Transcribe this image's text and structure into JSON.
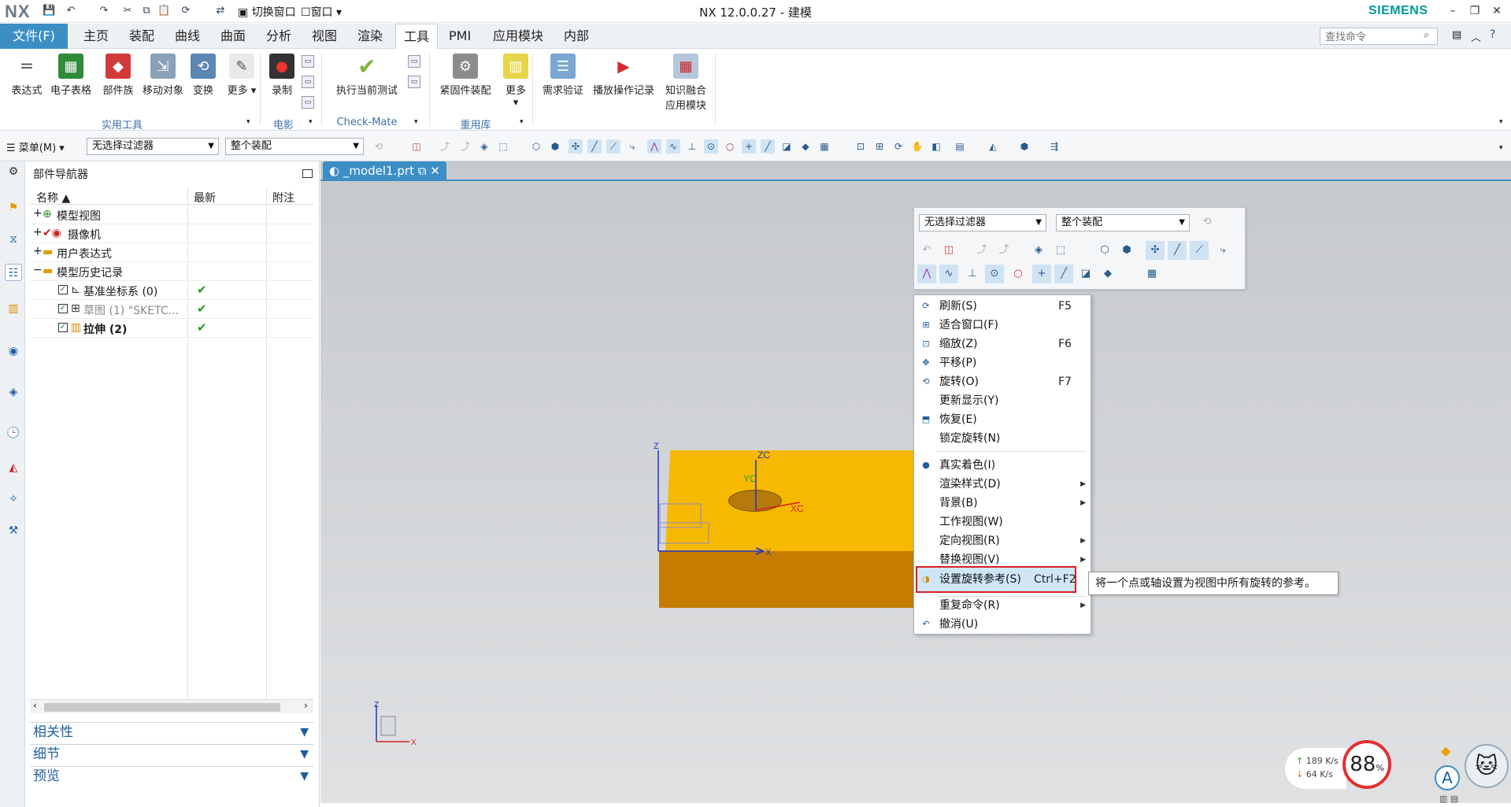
{
  "app": {
    "logo": "NX",
    "title": "NX 12.0.0.27 - 建模",
    "brand": "SIEMENS"
  },
  "quick_access": {
    "switch_window": "切换窗口",
    "window": "窗口"
  },
  "tabs": {
    "file": "文件(F)",
    "items": [
      "主页",
      "装配",
      "曲线",
      "曲面",
      "分析",
      "视图",
      "渲染",
      "工具",
      "PMI",
      "应用模块",
      "内部"
    ],
    "active": "工具"
  },
  "search": {
    "placeholder": "查找命令"
  },
  "ribbon": {
    "buttons": [
      "表达式",
      "电子表格",
      "部件族",
      "移动对象",
      "变换",
      "更多",
      "录制",
      "执行当前测试",
      "紧固件装配",
      "更多",
      "需求验证",
      "播放操作记录",
      "知识融合",
      "应用模块"
    ],
    "groups": [
      "实用工具",
      "电影",
      "Check-Mate",
      "重用库"
    ]
  },
  "toolbar": {
    "menu": "菜单(M)",
    "filter": "无选择过滤器",
    "scope": "整个装配"
  },
  "navigator": {
    "title": "部件导航器",
    "columns": [
      "名称",
      "最新",
      "附注"
    ],
    "rows": [
      {
        "label": "模型视图",
        "expand": "+"
      },
      {
        "label": "摄像机",
        "expand": "+"
      },
      {
        "label": "用户表达式",
        "expand": "+"
      },
      {
        "label": "模型历史记录",
        "expand": "−"
      },
      {
        "label": "基准坐标系 (0)",
        "latest": "✔"
      },
      {
        "label": "草图 (1) \"SKETC...",
        "latest": "✔"
      },
      {
        "label": "拉伸 (2)",
        "latest": "✔"
      }
    ],
    "panels": [
      "相关性",
      "细节",
      "预览"
    ]
  },
  "document": {
    "tab": "_model1.prt"
  },
  "axes": {
    "z": "Z",
    "x": "X",
    "zc": "ZC",
    "yc": "YC",
    "xc": "XC"
  },
  "popup": {
    "filter": "无选择过滤器",
    "scope": "整个装配"
  },
  "context_menu": {
    "items": [
      {
        "label": "刷新(S)",
        "key": "F5",
        "icon": "refresh-icon"
      },
      {
        "label": "适合窗口(F)",
        "key": "",
        "icon": "fit-icon"
      },
      {
        "label": "缩放(Z)",
        "key": "F6",
        "icon": "zoom-icon"
      },
      {
        "label": "平移(P)",
        "key": "",
        "icon": "pan-icon"
      },
      {
        "label": "旋转(O)",
        "key": "F7",
        "icon": "rotate-icon"
      },
      {
        "label": "更新显示(Y)",
        "key": "",
        "icon": ""
      },
      {
        "label": "恢复(E)",
        "key": "",
        "icon": "restore-icon"
      },
      {
        "label": "锁定旋转(N)",
        "key": "",
        "icon": ""
      },
      {
        "label": "真实着色(I)",
        "key": "",
        "icon": "shading-icon"
      },
      {
        "label": "渲染样式(D)",
        "key": "",
        "icon": "",
        "submenu": true
      },
      {
        "label": "背景(B)",
        "key": "",
        "icon": "",
        "submenu": true
      },
      {
        "label": "工作视图(W)",
        "key": "",
        "icon": ""
      },
      {
        "label": "定向视图(R)",
        "key": "",
        "icon": "",
        "submenu": true
      },
      {
        "label": "替换视图(V)",
        "key": "",
        "icon": "",
        "submenu": true
      },
      {
        "label": "设置旋转参考(S)",
        "key": "Ctrl+F2",
        "icon": "rotation-ref-icon"
      },
      {
        "label": "重复命令(R)",
        "key": "",
        "icon": "",
        "submenu": true
      },
      {
        "label": "撤消(U)",
        "key": "",
        "icon": "undo-icon"
      }
    ],
    "tooltip": "将一个点或轴设置为视图中所有旋转的参考。"
  },
  "status": {
    "upload": "189 K/s",
    "download": "64 K/s",
    "speed": "88",
    "speed_unit": "%",
    "font_button": "A"
  },
  "colors": {
    "accent": "#3c8fc5",
    "model_top": "#f7b800",
    "model_front": "#c57c00",
    "highlight_border": "#d62020"
  }
}
